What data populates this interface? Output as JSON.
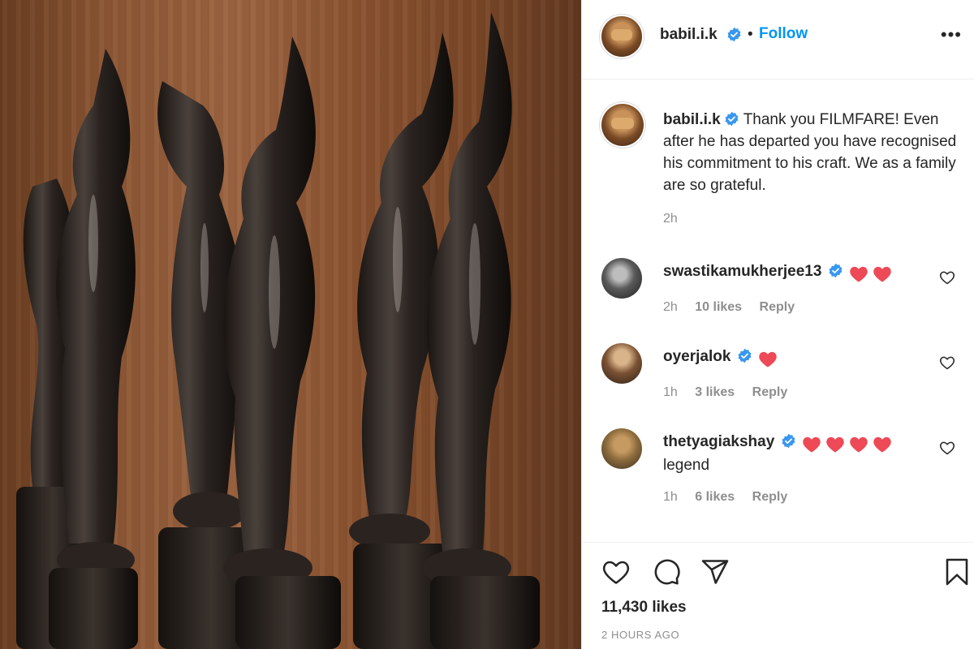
{
  "post": {
    "username": "babil.i.k",
    "follow_label": "Follow",
    "more_icon": "more-options-icon",
    "caption_text": "Thank you FILMFARE! Even after he has departed you have recognised his commitment to his craft. We as a family are so grateful.",
    "caption_time": "2h",
    "likes": "11,430 likes",
    "timestamp": "2 HOURS AGO"
  },
  "comments": [
    {
      "username": "swastikamukherjee13",
      "text": "",
      "hearts": 2,
      "time": "2h",
      "likes": "10 likes",
      "reply": "Reply"
    },
    {
      "username": "oyerjalok",
      "text": "",
      "hearts": 1,
      "time": "1h",
      "likes": "3 likes",
      "reply": "Reply"
    },
    {
      "username": "thetyagiakshay",
      "text": "legend",
      "hearts": 4,
      "time": "1h",
      "likes": "6 likes",
      "reply": "Reply"
    }
  ],
  "colors": {
    "accent": "#0095f6",
    "heart": "#ed4956",
    "text": "#262626",
    "muted": "#8e8e8e",
    "border": "#efefef"
  },
  "icons": [
    "verified-badge-icon",
    "heart-icon",
    "comment-icon",
    "share-icon",
    "bookmark-icon",
    "more-options-icon"
  ]
}
